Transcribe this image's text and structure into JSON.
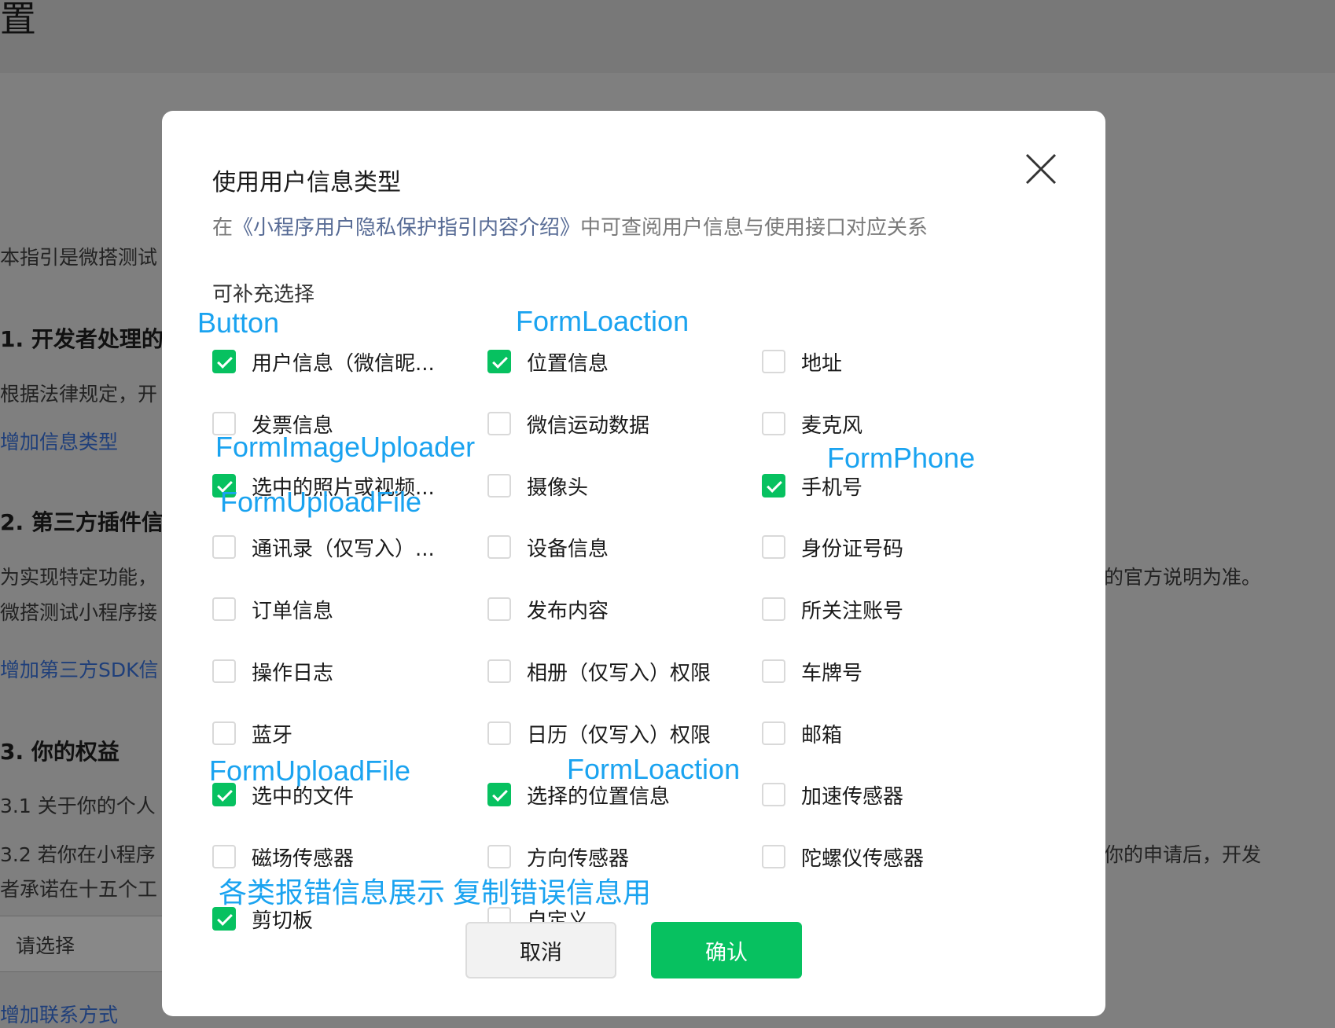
{
  "background": {
    "page_title": "置",
    "intro": "本指引是微搭测试",
    "section1_heading": "1. 开发者处理的",
    "section1_text": "根据法律规定，开",
    "add_info_type_link": "增加信息类型",
    "section2_heading": "2. 第三方插件信",
    "section2_text_a": "为实现特定功能，",
    "section2_text_a_right": "的官方说明为准。",
    "section2_text_b": "微搭测试小程序接",
    "add_sdk_link": "增加第三方SDK信",
    "section3_heading": "3. 你的权益",
    "item_3_1": "3.1  关于你的个人",
    "item_3_2": "3.2  若你在小程序",
    "item_3_2_right": "你的申请后，开发",
    "item_3_2_line2": "者承诺在十五个工",
    "select_placeholder": "请选择",
    "add_contact_link": "增加联系方式"
  },
  "modal": {
    "title": "使用用户信息类型",
    "hint_prefix": "在",
    "hint_link": "《小程序用户隐私保护指引内容介绍》",
    "hint_suffix": "中可查阅用户信息与使用接口对应关系",
    "section_label": "可补充选择",
    "options": [
      {
        "label": "用户信息（微信昵...",
        "checked": true
      },
      {
        "label": "位置信息",
        "checked": true
      },
      {
        "label": "地址",
        "checked": false
      },
      {
        "label": "发票信息",
        "checked": false
      },
      {
        "label": "微信运动数据",
        "checked": false
      },
      {
        "label": "麦克风",
        "checked": false
      },
      {
        "label": "选中的照片或视频...",
        "checked": true
      },
      {
        "label": "摄像头",
        "checked": false
      },
      {
        "label": "手机号",
        "checked": true
      },
      {
        "label": "通讯录（仅写入）...",
        "checked": false
      },
      {
        "label": "设备信息",
        "checked": false
      },
      {
        "label": "身份证号码",
        "checked": false
      },
      {
        "label": "订单信息",
        "checked": false
      },
      {
        "label": "发布内容",
        "checked": false
      },
      {
        "label": "所关注账号",
        "checked": false
      },
      {
        "label": "操作日志",
        "checked": false
      },
      {
        "label": "相册（仅写入）权限",
        "checked": false
      },
      {
        "label": "车牌号",
        "checked": false
      },
      {
        "label": "蓝牙",
        "checked": false
      },
      {
        "label": "日历（仅写入）权限",
        "checked": false
      },
      {
        "label": "邮箱",
        "checked": false
      },
      {
        "label": "选中的文件",
        "checked": true
      },
      {
        "label": "选择的位置信息",
        "checked": true
      },
      {
        "label": "加速传感器",
        "checked": false
      },
      {
        "label": "磁场传感器",
        "checked": false
      },
      {
        "label": "方向传感器",
        "checked": false
      },
      {
        "label": "陀螺仪传感器",
        "checked": false
      },
      {
        "label": "剪切板",
        "checked": true
      },
      {
        "label": "自定义",
        "checked": false
      }
    ],
    "annotations": [
      "Button",
      "FormLoaction",
      "FormImageUploader",
      "FormPhone",
      "FormUploadFile",
      "FormUploadFile",
      "FormLoaction",
      "各类报错信息展示 复制错误信息用"
    ],
    "cancel_label": "取消",
    "confirm_label": "确认"
  },
  "colors": {
    "accent_green": "#07c160",
    "link_blue": "#576b95",
    "annotation_blue": "#1aa3f0",
    "overlay_gray": "#7f7f7f"
  },
  "icons": {
    "close": "close-icon",
    "check": "checkmark-icon"
  }
}
